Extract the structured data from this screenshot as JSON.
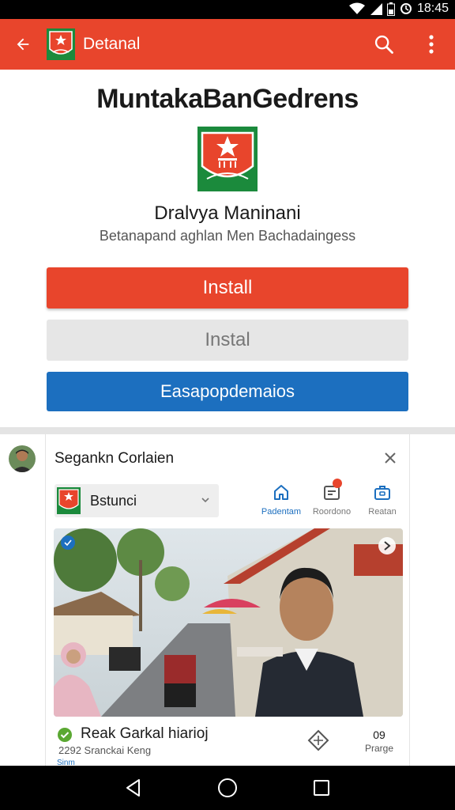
{
  "status_bar": {
    "time": "18:45",
    "icons": [
      "wifi-icon",
      "signal-icon",
      "battery-icon",
      "sync-icon"
    ]
  },
  "app_bar": {
    "title": "Detanal",
    "back_icon": "arrow-back-icon",
    "search_icon": "search-icon",
    "menu_icon": "more-vert-icon"
  },
  "detail": {
    "app_name": "MuntakaBanGedrens",
    "developer": "Dralvya Maninani",
    "tagline": "Betanapand aghlan Men Bachadaingess",
    "primary_button": "Install",
    "secondary_button": "Instal",
    "tertiary_button": "Easapopdemaios"
  },
  "feed": {
    "card_title": "Segankn Corlaien",
    "selector_label": "Bstunci",
    "tabs": [
      {
        "label": "Padentam",
        "icon": "home-icon",
        "active": true
      },
      {
        "label": "Roordono",
        "icon": "messages-icon",
        "active": false
      },
      {
        "label": "Reatan",
        "icon": "briefcase-icon",
        "active": false
      }
    ],
    "post": {
      "title": "Reak Garkal hiarioj",
      "subtitle": "2292 Sranckai Keng",
      "more_label": "Sinm",
      "count_value": "09",
      "count_label": "Prarge"
    }
  },
  "colors": {
    "brand_red": "#e8452c",
    "brand_blue": "#1c6fbf",
    "logo_green": "#1b8a3c"
  }
}
